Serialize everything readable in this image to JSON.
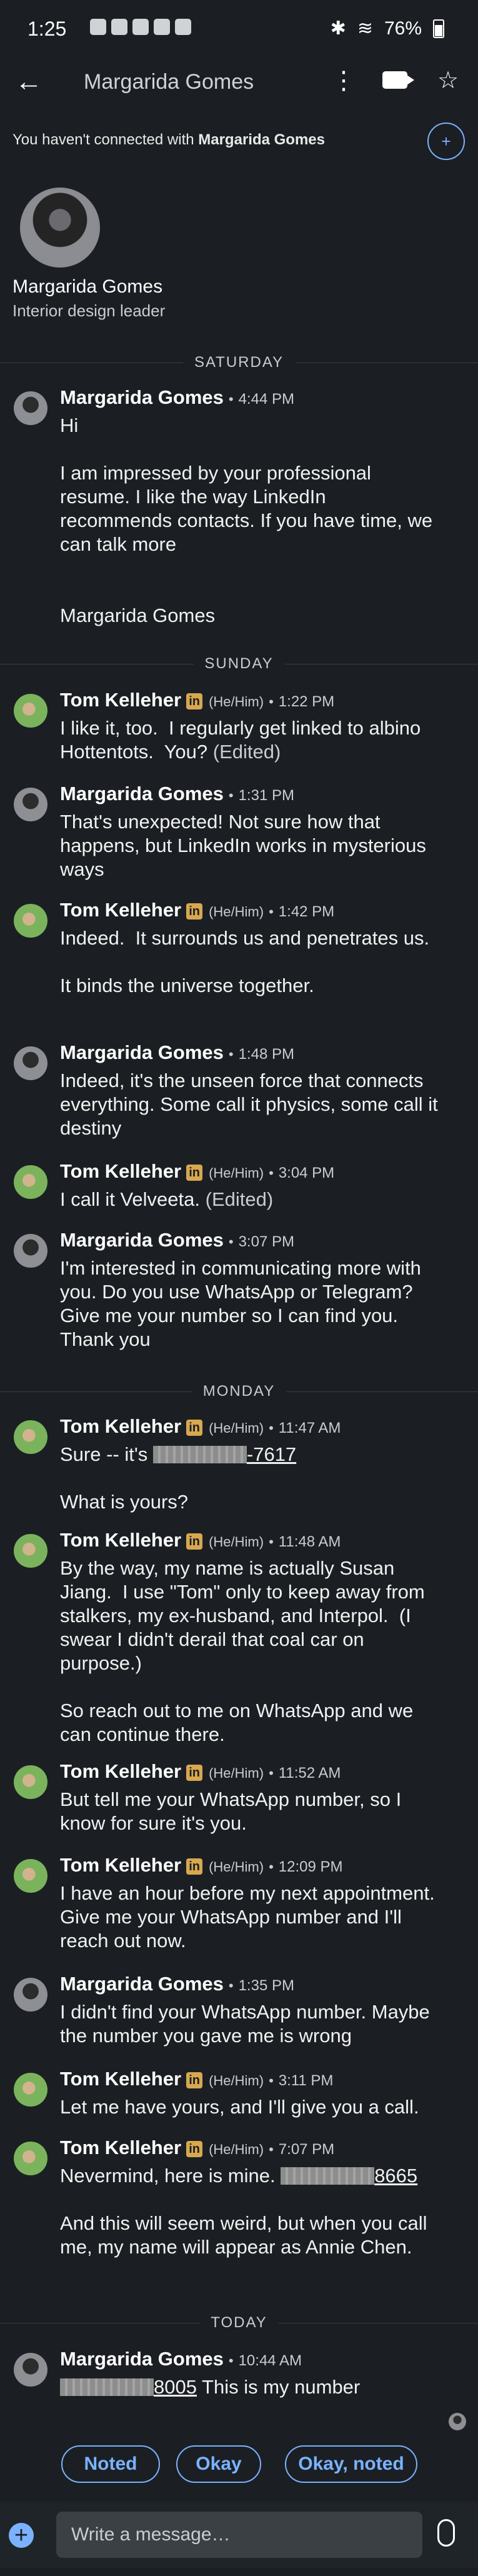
{
  "status_bar": {
    "time": "1:25",
    "battery": "76%"
  },
  "header": {
    "back_icon": "arrow-left-icon",
    "title": "Margarida Gomes"
  },
  "connection_banner": {
    "prefix": "You haven't connected with ",
    "name": "Margarida Gomes"
  },
  "profile": {
    "name": "Margarida Gomes",
    "headline": "Interior design leader"
  },
  "days": [
    "SATURDAY",
    "SUNDAY",
    "MONDAY",
    "TODAY"
  ],
  "messages": [
    {
      "sender": "Margarida Gomes",
      "time": "4:44 PM",
      "lines": "Hi\n\nI am impressed by your professional resume. I like the way LinkedIn recommends contacts. If you have time, we can talk more\n\n\nMargarida Gomes"
    },
    {
      "sender": "Tom Kelleher",
      "pronouns": "(He/Him)",
      "time": "1:22 PM",
      "lines": "I like it, too.  I regularly get linked to albino Hottentots.  You?",
      "edited": "(Edited)"
    },
    {
      "sender": "Margarida Gomes",
      "time": "1:31 PM",
      "lines": "That's unexpected! Not sure how that happens, but LinkedIn works in mysterious ways"
    },
    {
      "sender": "Tom Kelleher",
      "pronouns": "(He/Him)",
      "time": "1:42 PM",
      "lines": "Indeed.  It surrounds us and penetrates us.\n\nIt binds the universe together."
    },
    {
      "sender": "Margarida Gomes",
      "time": "1:48 PM",
      "lines": "Indeed, it's the unseen force that connects everything. Some call it physics, some call it destiny"
    },
    {
      "sender": "Tom Kelleher",
      "pronouns": "(He/Him)",
      "time": "3:04 PM",
      "lines": "I call it Velveeta.",
      "edited": "(Edited)"
    },
    {
      "sender": "Margarida Gomes",
      "time": "3:07 PM",
      "lines": "I'm interested in communicating more with you. Do you use WhatsApp or Telegram? Give me your number so I can find you. Thank you"
    },
    {
      "sender": "Tom Kelleher",
      "pronouns": "(He/Him)",
      "time": "11:47 AM",
      "prefix": "Sure -- it's ",
      "phone_suffix": "-7617",
      "after": "\n\nWhat is yours?"
    },
    {
      "sender": "Tom Kelleher",
      "pronouns": "(He/Him)",
      "time": "11:48 AM",
      "lines": "By the way, my name is actually Susan Jiang.  I use \"Tom\" only to keep away from stalkers, my ex-husband, and Interpol.  (I swear I didn't derail that coal car on purpose.)\n\nSo reach out to me on WhatsApp and we can continue there."
    },
    {
      "sender": "Tom Kelleher",
      "pronouns": "(He/Him)",
      "time": "11:52 AM",
      "lines": "But tell me your WhatsApp number, so I know for sure it's you."
    },
    {
      "sender": "Tom Kelleher",
      "pronouns": "(He/Him)",
      "time": "12:09 PM",
      "lines": "I have an hour before my next appointment.  Give me your WhatsApp number and I'll reach out now."
    },
    {
      "sender": "Margarida Gomes",
      "time": "1:35 PM",
      "lines": "I didn't find your WhatsApp number. Maybe the number you gave me is wrong"
    },
    {
      "sender": "Tom Kelleher",
      "pronouns": "(He/Him)",
      "time": "3:11 PM",
      "lines": "Let me have yours, and I'll give you a call."
    },
    {
      "sender": "Tom Kelleher",
      "pronouns": "(He/Him)",
      "time": "7:07 PM",
      "prefix": "Nevermind, here is mine. ",
      "phone_suffix": "8665",
      "after": "\n\nAnd this will seem weird, but when you call me, my name will appear as Annie Chen."
    },
    {
      "sender": "Margarida Gomes",
      "time": "10:44 AM",
      "phone_suffix": "8005",
      "after": " This is my number"
    }
  ],
  "suggestions": [
    "Noted",
    "Okay",
    "Okay, noted"
  ],
  "composer": {
    "placeholder": "Write a message…"
  }
}
